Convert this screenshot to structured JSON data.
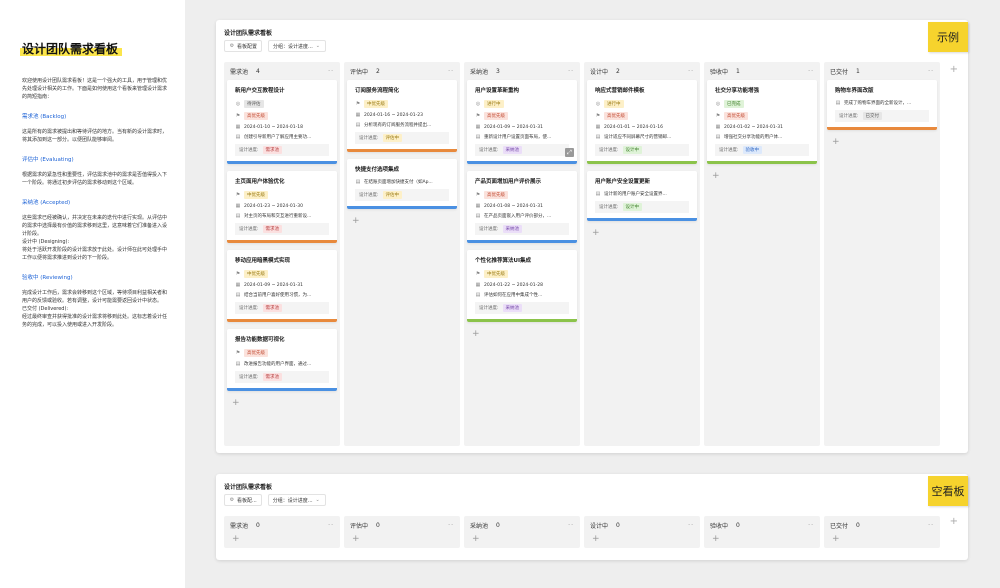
{
  "sidebar": {
    "title": "设计团队需求看板",
    "intro": "欢迎使用设计团队需求看板！这是一个强大的工具，用于管理和优先处理设计相关的工作。下面是如何使用这个看板来管理设计需求的简短指南：",
    "sections": [
      {
        "heading": "需求池 (Backlog)",
        "body": "这是所有的需求被提出和等待评估的地方。当有新的设计需求时，将其添加到这一部分。以便团队能够审阅。"
      },
      {
        "heading": "评估中 (Evaluating)",
        "body": "根据需求的紧急性和重要性，评估需求池中的需求是否值得投入下一个阶段。将通过初步评估的需求移动到这个区域。"
      },
      {
        "heading": "采纳池 (Accepted)",
        "body": "这些需求已经被确认，并决定在未来的迭代中进行实现。从评估中的需求中选择最有价值的需求移到这里，这意味着它们准备进入设计阶段。\n设计中 (Designing):\n将处于活跃开发阶段的设计需求放于此处。设计师在此可处理手中工作以便将需求推进到设计的下一阶段。"
      },
      {
        "heading": "验收中 (Reviewing)",
        "body": "完成设计工作后，需求会转移到这个区域，等待项目利益相关者和用户的反馈或验收。若有调整，设计可能需要返回设计中状态。\n已交付 (Delivered):\n经过最终审查并获得批准的设计需求将移到此处。这标志着设计任务的完成，可以投入使用或进入开发阶段。"
      }
    ]
  },
  "toolbar": {
    "config_label": "看板配置",
    "config_label_short": "看板配...",
    "group_label": "分组：设计进度..."
  },
  "boards": [
    {
      "title": "设计团队需求看板",
      "sticky": "示例",
      "lanes": [
        {
          "name": "需求池",
          "count": "4",
          "cards": [
            {
              "title": "新用户交互教程设计",
              "status": "待评估",
              "priority": "高优先级",
              "date": "2024-01-10 ~ 2024-01-18",
              "desc": "创建引导新用户了解应用主要功...",
              "design_label": "设计进度:",
              "design": "需求池",
              "color": "blue"
            },
            {
              "title": "主页面用户体验优化",
              "priority": "中优先级",
              "date": "2024-01-23 ~ 2024-01-30",
              "desc": "对主页的布局和交互进行重新设...",
              "design_label": "设计进度:",
              "design": "需求池",
              "color": "orange"
            },
            {
              "title": "移动应用暗黑模式实现",
              "priority": "中优先级",
              "date": "2024-01-09 ~ 2024-01-31",
              "desc": "结合当前用户喜好使用习惯，为...",
              "design_label": "设计进度:",
              "design": "需求池",
              "color": "orange"
            },
            {
              "title": "报告功能数据可视化",
              "priority": "高优先级",
              "desc": "改进报告功能的用户界面，通过...",
              "design_label": "设计进度:",
              "design": "需求池",
              "color": "blue"
            }
          ]
        },
        {
          "name": "评估中",
          "count": "2",
          "cards": [
            {
              "title": "订阅服务流程简化",
              "priority": "中优先级",
              "date": "2024-01-16 ~ 2024-01-23",
              "desc": "分析现有的订阅服务流程并提出...",
              "design_label": "设计进度:",
              "design": "评估中",
              "color": "orange"
            },
            {
              "title": "快捷支付选项集成",
              "desc": "在结账页面增加快捷支付（如Ap...",
              "design_label": "设计进度:",
              "design": "评估中",
              "color": "blue"
            }
          ]
        },
        {
          "name": "采纳池",
          "count": "3",
          "cards": [
            {
              "title": "用户设置革新重构",
              "status": "进行中",
              "priority": "高优先级",
              "date": "2024-01-09 ~ 2024-01-31",
              "desc": "重新设计用户设置页面布局，使...",
              "design_label": "设计进度:",
              "design": "采纳池",
              "color": "blue",
              "expand": true
            },
            {
              "title": "产品页面增加用户评价展示",
              "priority": "高优先级",
              "date": "2024-01-08 ~ 2024-01-31",
              "desc": "在产品页面嵌入用户评价部分，...",
              "design_label": "设计进度:",
              "design": "采纳池",
              "color": "blue"
            },
            {
              "title": "个性化推荐算法UI集成",
              "priority": "中优先级",
              "date": "2024-01-22 ~ 2024-01-28",
              "desc": "评估如何在应用中集成个性...",
              "design_label": "设计进度:",
              "design": "采纳池",
              "color": "green"
            }
          ]
        },
        {
          "name": "设计中",
          "count": "2",
          "cards": [
            {
              "title": "响应式营销邮件模板",
              "status": "进行中",
              "priority": "高优先级",
              "date": "2024-01-01 ~ 2024-01-16",
              "desc": "设计适应不同屏幕尺寸的营销邮...",
              "design_label": "设计进度:",
              "design": "设计中",
              "color": "green"
            },
            {
              "title": "用户账户安全设置更新",
              "desc": "设计新的用户账户安全设置界...",
              "design_label": "设计进度:",
              "design": "设计中",
              "color": "blue"
            }
          ]
        },
        {
          "name": "验收中",
          "count": "1",
          "cards": [
            {
              "title": "社交分享功能增强",
              "status": "已完成",
              "priority": "高优先级",
              "date": "2024-01-02 ~ 2024-01-31",
              "desc": "增强社交分享功能的用户体...",
              "design_label": "设计进度:",
              "design": "验收中",
              "color": "green"
            }
          ]
        },
        {
          "name": "已交付",
          "count": "1",
          "cards": [
            {
              "title": "购物车界面改版",
              "desc": "完成了购物车界面的全新设计，...",
              "design_label": "设计进度:",
              "design": "已交付",
              "color": "orange"
            }
          ]
        }
      ]
    },
    {
      "title": "设计团队需求看板",
      "sticky": "空看板",
      "lanes": [
        {
          "name": "需求池",
          "count": "0",
          "cards": []
        },
        {
          "name": "评估中",
          "count": "0",
          "cards": []
        },
        {
          "name": "采纳池",
          "count": "0",
          "cards": []
        },
        {
          "name": "设计中",
          "count": "0",
          "cards": []
        },
        {
          "name": "验收中",
          "count": "0",
          "cards": []
        },
        {
          "name": "已交付",
          "count": "0",
          "cards": []
        }
      ]
    }
  ],
  "tag_colors": {
    "待评估": "gray",
    "进行中": "yellow",
    "已完成": "green",
    "高优先级": "red",
    "中优先级": "yellow",
    "需求池": "pink",
    "评估中": "yellow",
    "采纳池": "purple",
    "设计中": "green",
    "验收中": "blue",
    "已交付": "gray"
  }
}
